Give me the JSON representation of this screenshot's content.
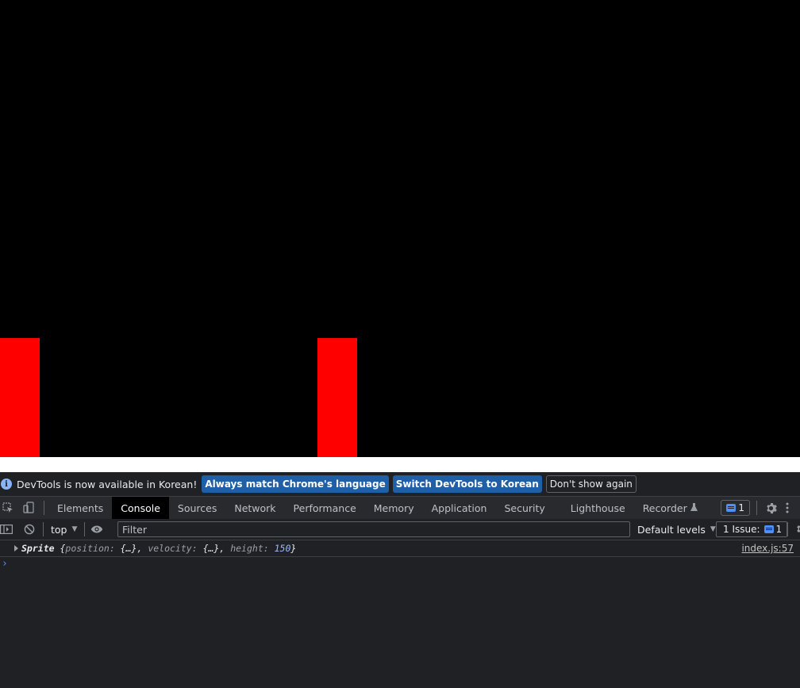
{
  "infobar": {
    "message": "DevTools is now available in Korean!",
    "match_language_label": "Always match Chrome's language",
    "switch_language_label": "Switch DevTools to Korean",
    "dismiss_label": "Don't show again"
  },
  "tabs": [
    "Elements",
    "Console",
    "Sources",
    "Network",
    "Performance",
    "Memory",
    "Application",
    "Security",
    "Lighthouse",
    "Recorder"
  ],
  "active_tab": "Console",
  "messages_badge_count": "1",
  "console_toolbar": {
    "context": "top",
    "filter_placeholder": "Filter",
    "levels": "Default levels",
    "issues_label": "1 Issue:",
    "issues_count": "1"
  },
  "log": {
    "object_name": "Sprite",
    "open_brace": "{",
    "prop1": "position",
    "sep1": ": ",
    "val1": "{…}",
    "comma1": ", ",
    "prop2": "velocity",
    "sep2": ": ",
    "val2": "{…}",
    "comma2": ", ",
    "prop3": "height",
    "sep3": ": ",
    "val3": "150",
    "close_brace": "}",
    "source": "index.js:57"
  },
  "prompt_symbol": "›",
  "colors": {
    "sprite": "#ff0000",
    "canvas_bg": "#000000",
    "accent": "#1f5fa8"
  }
}
